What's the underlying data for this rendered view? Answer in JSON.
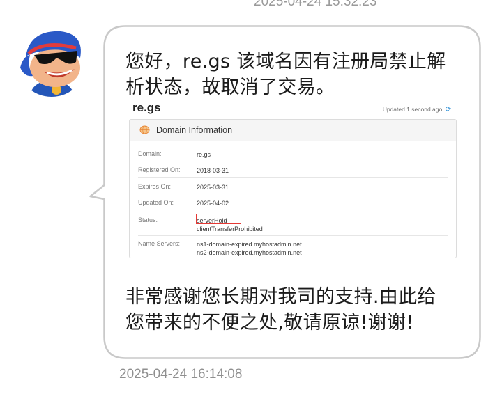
{
  "timestamps": {
    "top": "2025-04-24 15:32:23",
    "bottom": "2025-04-24 16:14:08"
  },
  "message": {
    "line1": "您好，re.gs 该域名因有注册局禁止解",
    "line2": "析状态，故取消了交易。",
    "line3": "非常感谢您长期对我司的支持.由此给",
    "line4": "您带来的不便之处,敬请原谅!谢谢!"
  },
  "whois": {
    "domain_title": "re.gs",
    "updated_text": "Updated 1 second ago",
    "panel_title": "Domain Information",
    "rows": [
      {
        "label": "Domain:",
        "value": "re.gs"
      },
      {
        "label": "Registered On:",
        "value": "2018-03-31"
      },
      {
        "label": "Expires On:",
        "value": "2025-03-31"
      },
      {
        "label": "Updated On:",
        "value": "2025-04-02"
      },
      {
        "label": "Status:",
        "value": "serverHold",
        "value2": "clientTransferProhibited"
      },
      {
        "label": "Name Servers:",
        "value": "ns1-domain-expired.myhostadmin.net",
        "value2": "ns2-domain-expired.myhostadmin.net"
      }
    ]
  },
  "colors": {
    "bubble_border": "#c9c9c9",
    "bubble_fill": "#ffffff",
    "highlight_box": "#e53935",
    "timestamp": "#9a9a9a"
  },
  "icons": {
    "avatar": "cartoon-avatar-icon",
    "globe": "globe-icon",
    "refresh": "refresh-icon"
  }
}
